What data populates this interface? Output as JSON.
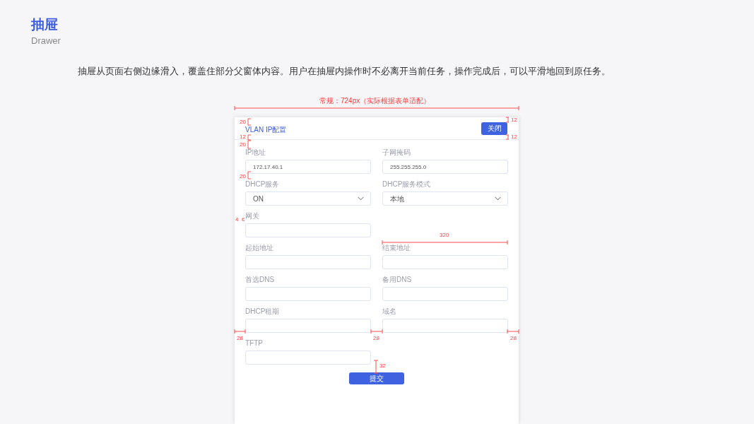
{
  "page": {
    "title": "抽屉",
    "subtitle": "Drawer",
    "description": "抽屉从页面右侧边缘滑入，覆盖住部分父窗体内容。用户在抽屉内操作时不必离开当前任务，操作完成后，可以平滑地回到原任务。"
  },
  "drawer": {
    "title": "VLAN IP配置",
    "close_button": "关闭",
    "fields": [
      {
        "label": "IP地址",
        "kind": "input",
        "value": "172.17.40.1"
      },
      {
        "label": "子网掩码",
        "kind": "input",
        "value": "255.255.255.0"
      },
      {
        "label": "DHCP服务",
        "kind": "select",
        "value": "ON"
      },
      {
        "label": "DHCP服务模式",
        "kind": "select",
        "value": "本地"
      },
      {
        "label": "网关",
        "kind": "input"
      },
      {
        "kind": "spacer"
      },
      {
        "label": "起始地址",
        "kind": "input"
      },
      {
        "label": "结束地址",
        "kind": "input"
      },
      {
        "label": "首选DNS",
        "kind": "input"
      },
      {
        "label": "备用DNS",
        "kind": "input"
      },
      {
        "label": "DHCP租期",
        "kind": "input"
      },
      {
        "label": "域名",
        "kind": "input"
      },
      {
        "label": "TFTP",
        "kind": "input"
      }
    ],
    "submit_button": "提交"
  },
  "annotations": [
    "常规：724px（实际根据表单适配）",
    "20",
    "12",
    "12",
    "20",
    "12",
    "20",
    "4",
    "320",
    "28",
    "28",
    "28",
    "32"
  ]
}
